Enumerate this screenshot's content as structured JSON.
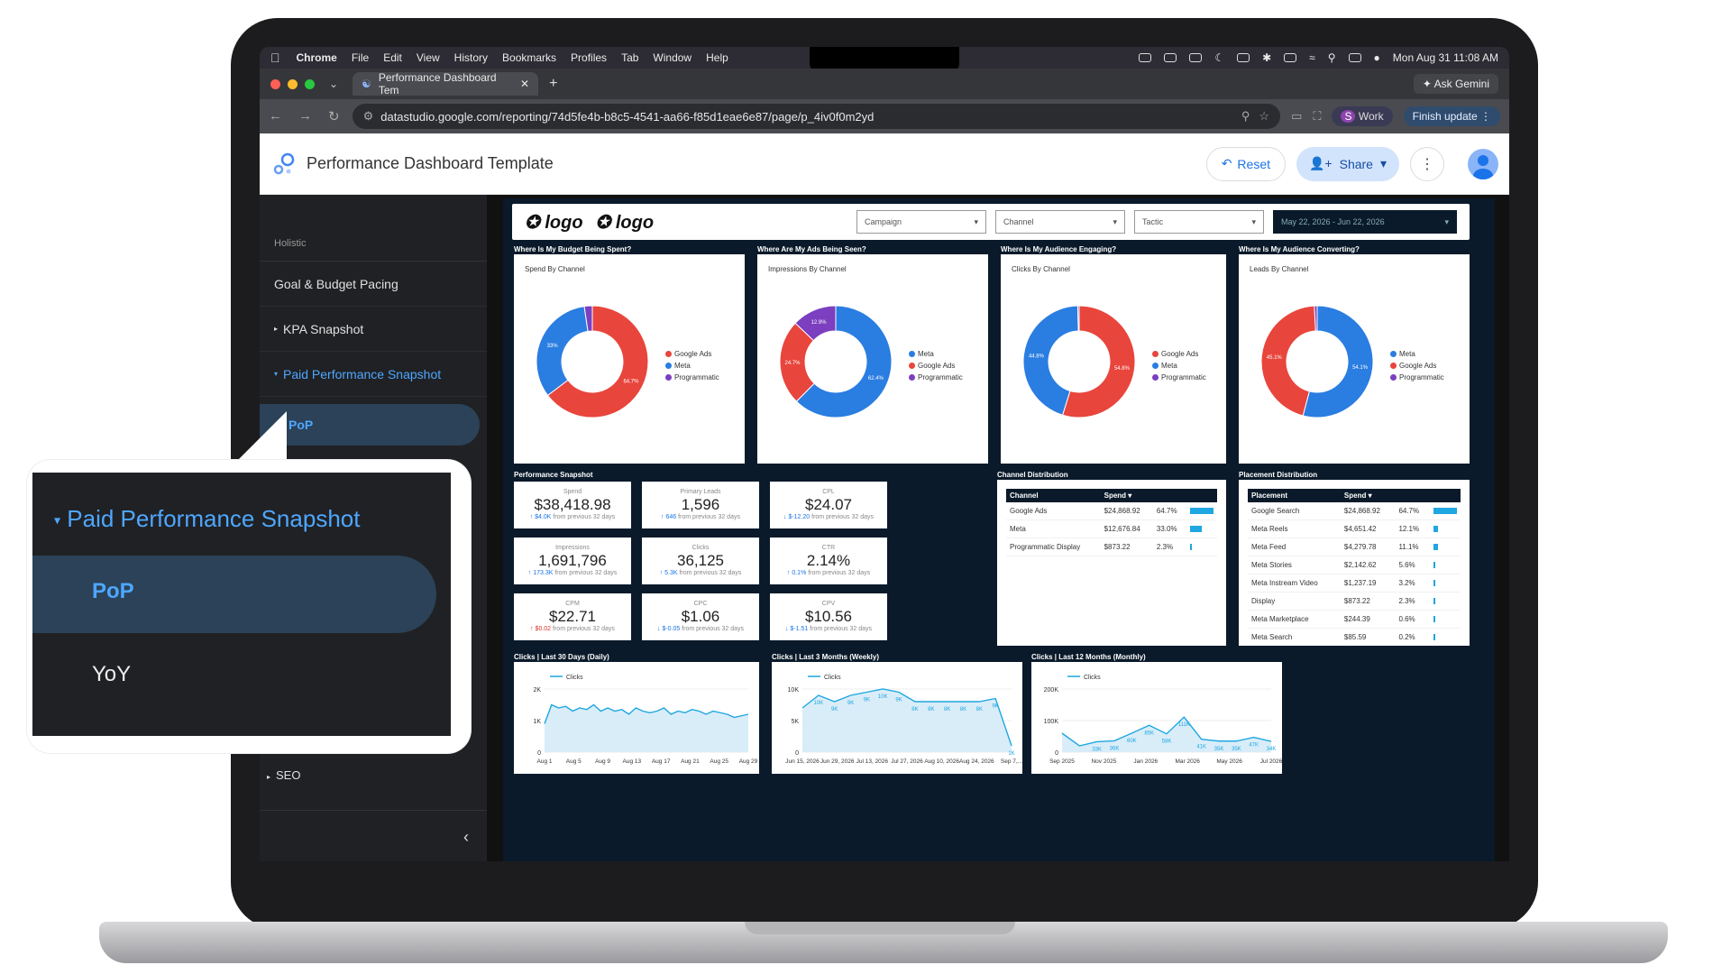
{
  "os_menu": {
    "app": "Chrome",
    "items": [
      "File",
      "Edit",
      "View",
      "History",
      "Bookmarks",
      "Profiles",
      "Tab",
      "Window",
      "Help"
    ],
    "clock": "Mon Aug 31  11:08 AM"
  },
  "browser": {
    "tab_title": "Performance Dashboard Tem",
    "ask_gemini": "Ask Gemini",
    "url": "datastudio.google.com/reporting/74d5fe4b-b8c5-4541-aa66-f85d1eae6e87/page/p_4iv0f0m2yd",
    "profile_label": "Work",
    "profile_initial": "S",
    "finish_update": "Finish update"
  },
  "app": {
    "title": "Performance Dashboard Template",
    "reset": "Reset",
    "share": "Share"
  },
  "sidebar": {
    "group": "Holistic",
    "items": [
      "Goal & Budget Pacing",
      "KPA Snapshot",
      "Paid Performance Snapshot"
    ],
    "sub_active": "PoP",
    "seo": "SEO"
  },
  "callout": {
    "title": "Paid Performance Snapshot",
    "active": "PoP",
    "other": "YoY"
  },
  "report": {
    "logos": [
      "logo",
      "logo"
    ],
    "filters": [
      "Campaign",
      "Channel",
      "Tactic"
    ],
    "date_range": "May 22, 2026 - Jun 22, 2026",
    "donuts": [
      {
        "section": "Where Is My Budget Being Spent?",
        "title": "Spend By Channel",
        "slices": [
          {
            "label": "Google Ads",
            "value": 64.7,
            "color": "#e8453c"
          },
          {
            "label": "Meta",
            "value": 33.0,
            "color": "#2a7de1"
          },
          {
            "label": "Programmatic",
            "value": 2.3,
            "color": "#7b3fbf"
          }
        ],
        "labels_shown": [
          "33%",
          "64.7%"
        ]
      },
      {
        "section": "Where Are My Ads Being Seen?",
        "title": "Impressions By Channel",
        "slices": [
          {
            "label": "Meta",
            "value": 62.4,
            "color": "#2a7de1"
          },
          {
            "label": "Google Ads",
            "value": 24.7,
            "color": "#e8453c"
          },
          {
            "label": "Programmatic",
            "value": 12.9,
            "color": "#7b3fbf"
          }
        ],
        "labels_shown": [
          "12.9%",
          "24.7%",
          "62.4%"
        ]
      },
      {
        "section": "Where Is My Audience Engaging?",
        "title": "Clicks By Channel",
        "slices": [
          {
            "label": "Google Ads",
            "value": 54.8,
            "color": "#e8453c"
          },
          {
            "label": "Meta",
            "value": 44.8,
            "color": "#2a7de1"
          },
          {
            "label": "Programmatic",
            "value": 0.4,
            "color": "#7b3fbf"
          }
        ],
        "labels_shown": [
          "44.8%",
          "54.8%"
        ]
      },
      {
        "section": "Where Is My Audience Converting?",
        "title": "Leads By Channel",
        "slices": [
          {
            "label": "Meta",
            "value": 54.1,
            "color": "#2a7de1"
          },
          {
            "label": "Google Ads",
            "value": 45.1,
            "color": "#e8453c"
          },
          {
            "label": "Programmatic",
            "value": 0.8,
            "color": "#7b3fbf"
          }
        ],
        "labels_shown": [
          "45.1%",
          "54.1%"
        ]
      }
    ],
    "snapshot_title": "Performance Snapshot",
    "metrics": [
      {
        "label": "Spend",
        "value": "$38,418.98",
        "arrow": "up",
        "delta": "$4.0K",
        "suffix": "from previous 32 days"
      },
      {
        "label": "Primary Leads",
        "value": "1,596",
        "arrow": "up",
        "delta": "646",
        "suffix": "from previous 32 days"
      },
      {
        "label": "CPL",
        "value": "$24.07",
        "arrow": "down",
        "delta": "$-12.20",
        "suffix": "from previous 32 days"
      },
      {
        "label": "Impressions",
        "value": "1,691,796",
        "arrow": "up",
        "delta": "173.3K",
        "suffix": "from previous 32 days"
      },
      {
        "label": "Clicks",
        "value": "36,125",
        "arrow": "up",
        "delta": "5.3K",
        "suffix": "from previous 32 days"
      },
      {
        "label": "CTR",
        "value": "2.14%",
        "arrow": "up",
        "delta": "0.1%",
        "suffix": "from previous 32 days"
      },
      {
        "label": "CPM",
        "value": "$22.71",
        "arrow": "up",
        "delta": "$0.02",
        "suffix": "from previous 32 days"
      },
      {
        "label": "CPC",
        "value": "$1.06",
        "arrow": "down",
        "delta": "$-0.05",
        "suffix": "from previous 32 days"
      },
      {
        "label": "CPV",
        "value": "$10.56",
        "arrow": "down",
        "delta": "$-1.51",
        "suffix": "from previous 32 days"
      }
    ],
    "channel_dist": {
      "title": "Channel Distribution",
      "headers": [
        "Channel",
        "Spend ▾"
      ],
      "rows": [
        [
          "Google Ads",
          "$24,868.92",
          "64.7%",
          0.647
        ],
        [
          "Meta",
          "$12,676.84",
          "33.0%",
          0.33
        ],
        [
          "Programmatic Display",
          "$873.22",
          "2.3%",
          0.023
        ]
      ]
    },
    "placement_dist": {
      "title": "Placement Distribution",
      "headers": [
        "Placement",
        "Spend ▾"
      ],
      "rows": [
        [
          "Google Search",
          "$24,868.92",
          "64.7%",
          0.647
        ],
        [
          "Meta Reels",
          "$4,651.42",
          "12.1%",
          0.121
        ],
        [
          "Meta Feed",
          "$4,279.78",
          "11.1%",
          0.111
        ],
        [
          "Meta Stories",
          "$2,142.62",
          "5.6%",
          0.056
        ],
        [
          "Meta Instream Video",
          "$1,237.19",
          "3.2%",
          0.032
        ],
        [
          "Display",
          "$873.22",
          "2.3%",
          0.023
        ],
        [
          "Meta Marketplace",
          "$244.39",
          "0.6%",
          0.006
        ],
        [
          "Meta Search",
          "$85.59",
          "0.2%",
          0.002
        ]
      ]
    }
  },
  "chart_data": [
    {
      "type": "area",
      "title": "Clicks | Last 30 Days (Daily)",
      "series": [
        {
          "name": "Clicks",
          "values": [
            900,
            1500,
            1400,
            1450,
            1300,
            1400,
            1350,
            1500,
            1300,
            1400,
            1300,
            1350,
            1200,
            1400,
            1300,
            1250,
            1300,
            1400,
            1200,
            1300,
            1250,
            1350,
            1300,
            1200,
            1300,
            1250,
            1200,
            1100,
            1150,
            1200
          ]
        }
      ],
      "ylim": [
        0,
        2000
      ],
      "yticks": [
        "0",
        "1K",
        "2K"
      ],
      "xticks": [
        "Aug 1",
        "Aug 5",
        "Aug 9",
        "Aug 13",
        "Aug 17",
        "Aug 21",
        "Aug 25",
        "Aug 29"
      ]
    },
    {
      "type": "area",
      "title": "Clicks | Last 3 Months (Weekly)",
      "series": [
        {
          "name": "Clicks",
          "values": [
            7000,
            9000,
            8000,
            9000,
            9500,
            10000,
            9500,
            8000,
            8000,
            8000,
            8000,
            8000,
            8500,
            1000
          ]
        }
      ],
      "data_labels": [
        "",
        "10K",
        "9K",
        "9K",
        "9K",
        "10K",
        "9K",
        "8K",
        "8K",
        "8K",
        "8K",
        "8K",
        "9K",
        "1K"
      ],
      "ylim": [
        0,
        10000
      ],
      "yticks": [
        "0",
        "5K",
        "10K"
      ],
      "xticks": [
        "Jun 15, 2026",
        "Jun 29, 2026",
        "Jul 13, 2026",
        "Jul 27, 2026",
        "Aug 10, 2026",
        "Aug 24, 2026",
        "Sep 7,..."
      ]
    },
    {
      "type": "area",
      "title": "Clicks | Last 12 Months (Monthly)",
      "series": [
        {
          "name": "Clicks",
          "values": [
            60000,
            20000,
            33000,
            36000,
            60000,
            85000,
            58000,
            111000,
            41000,
            35000,
            35000,
            47000,
            34000
          ]
        }
      ],
      "data_labels": [
        "",
        "",
        "33K",
        "36K",
        "60K",
        "85K",
        "58K",
        "111K",
        "41K",
        "35K",
        "35K",
        "47K",
        "34K"
      ],
      "ylim": [
        0,
        200000
      ],
      "yticks": [
        "0",
        "100K",
        "200K"
      ],
      "xticks": [
        "Sep 2025",
        "Nov 2025",
        "Jan 2026",
        "Mar 2026",
        "May 2026",
        "Jul 2026"
      ]
    }
  ]
}
